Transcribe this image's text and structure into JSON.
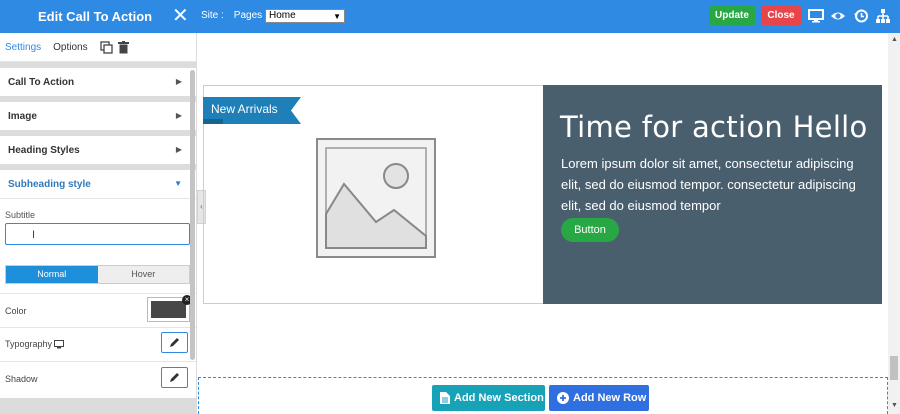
{
  "panel": {
    "title": "Edit Call To Action"
  },
  "topbar": {
    "site_label": "Site :",
    "pages_label": "Pages :",
    "pages_selected": "Home",
    "update_label": "Update",
    "close_label": "Close"
  },
  "sidebar": {
    "tabs": {
      "settings": "Settings",
      "options": "Options"
    },
    "accordion": [
      {
        "label": "Call To Action"
      },
      {
        "label": "Image"
      },
      {
        "label": "Heading Styles"
      },
      {
        "label": "Subheading style"
      }
    ],
    "subtitle_label": "Subtitle",
    "subtitle_value": "",
    "state_toggle": {
      "normal": "Normal",
      "hover": "Hover"
    },
    "color_label": "Color",
    "typography_label": "Typography",
    "shadow_label": "Shadow",
    "color_value": "#474747"
  },
  "canvas": {
    "ribbon": "New Arrivals",
    "heading": "Time for action Hello",
    "body": "Lorem ipsum dolor sit amet, consectetur adipiscing elit, sed do eiusmod tempor. consectetur adipiscing elit, sed do eiusmod tempor",
    "button_label": "Button",
    "add_section": "Add New Section",
    "add_row": "Add New Row"
  },
  "colors": {
    "accent": "#2f8ae3",
    "cta_background": "#4a5f6e",
    "success": "#28a745",
    "danger": "#e8454b"
  }
}
